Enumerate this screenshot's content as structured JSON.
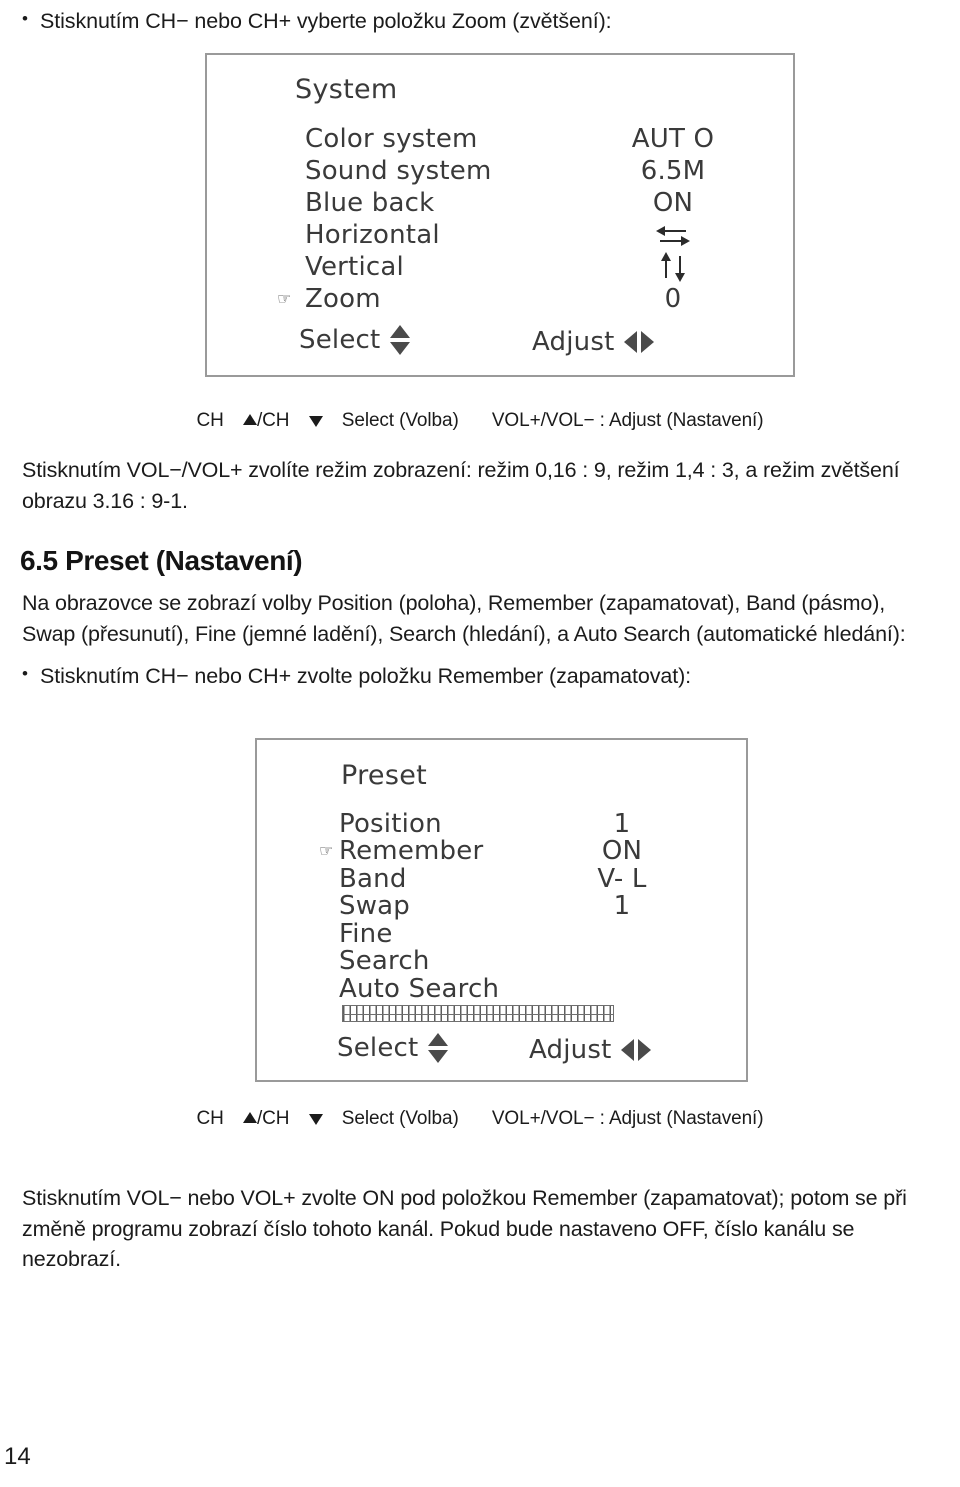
{
  "page": {
    "number": "14"
  },
  "bullets": {
    "zoom": "Stisknutím CH− nebo CH+ vyberte položku Zoom (zvětšení):",
    "remember": "Stisknutím CH− nebo CH+ zvolte položku Remember (zapamatovat):"
  },
  "osd_system": {
    "title": "System",
    "rows": [
      {
        "cursor": "",
        "label": "Color system",
        "value": "AUT O"
      },
      {
        "cursor": "",
        "label": "Sound system",
        "value": "6.5M"
      },
      {
        "cursor": "",
        "label": "Blue back",
        "value": "ON"
      },
      {
        "cursor": "",
        "label": "Horizontal",
        "value": "",
        "value_icon": "horizontal-arrows-icon"
      },
      {
        "cursor": "",
        "label": "Vertical",
        "value": "",
        "value_icon": "vertical-arrows-icon"
      },
      {
        "cursor": "☞",
        "label": "Zoom",
        "value": "0"
      }
    ],
    "footer": {
      "select_label": "Select",
      "select_icon": "up-down-triangles-icon",
      "adjust_label": "Adjust",
      "adjust_icon": "left-right-triangles-icon"
    }
  },
  "caption_1": {
    "ch": "CH",
    "slash": "/CH",
    "select": "Select (Volba)",
    "vol": "VOL+/VOL−  :  Adjust (Nastavení)"
  },
  "paragraph_1": "Stisknutím VOL−/VOL+ zvolíte režim zobrazení: režim 0,16 : 9, režim 1,4 : 3, a režim zvětšení obrazu 3.16 : 9-1.",
  "heading_65": "6.5 Preset (Nastavení)",
  "paragraph_2": "Na obrazovce se zobrazí volby Position (poloha), Remember (zapamatovat), Band (pásmo), Swap (přesunutí), Fine (jemné ladění), Search (hledání), a Auto Search (automatické hledání):",
  "osd_preset": {
    "title": "Preset",
    "rows": [
      {
        "cursor": "",
        "label": "Position",
        "value": "1"
      },
      {
        "cursor": "☞",
        "label": "Remember",
        "value": "ON"
      },
      {
        "cursor": "",
        "label": "Band",
        "value": "V- L"
      },
      {
        "cursor": "",
        "label": "Swap",
        "value": "1"
      },
      {
        "cursor": "",
        "label": "Fine",
        "value": ""
      },
      {
        "cursor": "",
        "label": "Search",
        "value": ""
      },
      {
        "cursor": "",
        "label": "Auto Search",
        "value": ""
      }
    ],
    "tuning_bar": "signal-level-bar",
    "footer": {
      "select_label": "Select",
      "select_icon": "up-down-triangles-icon",
      "adjust_label": "Adjust",
      "adjust_icon": "left-right-triangles-icon"
    }
  },
  "caption_2": {
    "ch": "CH",
    "slash": "/CH",
    "select": "Select (Volba)",
    "vol": "VOL+/VOL−  :  Adjust (Nastavení)"
  },
  "paragraph_3": "Stisknutím VOL− nebo VOL+ zvolte ON pod položkou Remember (zapamatovat); potom se při změně programu zobrazí číslo tohoto kanál. Pokud bude nastaveno OFF, číslo kanálu se nezobrazí."
}
